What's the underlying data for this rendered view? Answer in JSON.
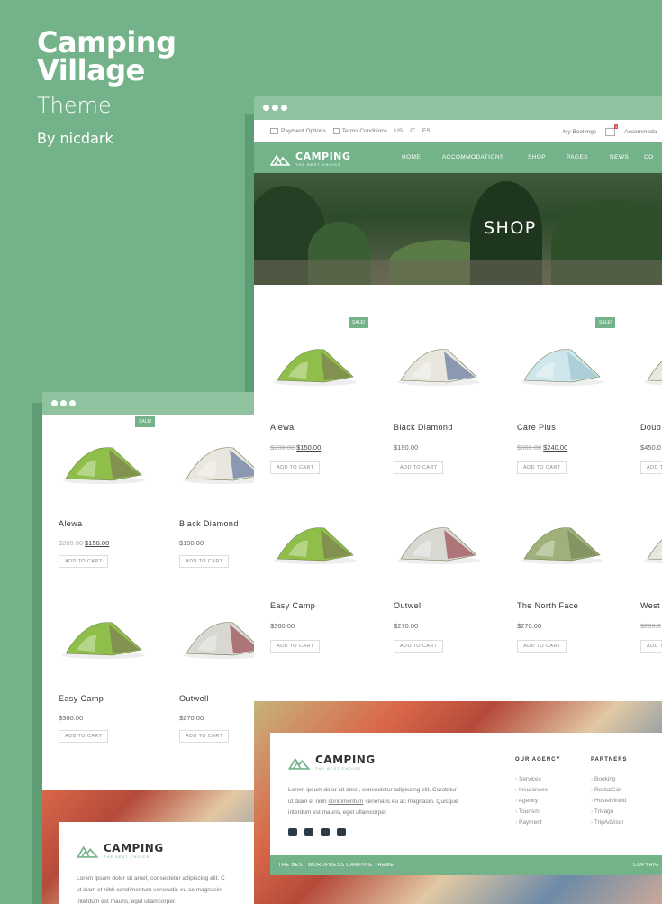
{
  "hero": {
    "title_line1": "Camping",
    "title_line2": "Village",
    "subtitle": "Theme",
    "byline": "By nicdark"
  },
  "topbar": {
    "payment": "Payment Options",
    "terms": "Terms Conditions",
    "langs": [
      "US",
      "IT",
      "ES"
    ],
    "bookings": "My Bookings",
    "cart_count": "1",
    "account": "Accommoda"
  },
  "logo": {
    "name": "CAMPING",
    "tagline": "THE BEST CHOICE"
  },
  "nav": [
    "HOME",
    "ACCOMMODATIONS",
    "SHOP",
    "PAGES",
    "NEWS",
    "CO"
  ],
  "banner": {
    "title": "SHOP"
  },
  "sale_badge": "SALE!",
  "add_to_cart": "ADD TO CART",
  "products": [
    {
      "name": "Alewa",
      "old_price": "$200.00",
      "price": "$150.00"
    },
    {
      "name": "Black Diamond",
      "old_price": "",
      "price": "$190.00"
    },
    {
      "name": "Care Plus",
      "old_price": "$300.00",
      "price": "$240.00"
    },
    {
      "name": "Doub",
      "old_price": "",
      "price": "$450.0"
    },
    {
      "name": "Easy Camp",
      "old_price": "",
      "price": "$360.00"
    },
    {
      "name": "Outwell",
      "old_price": "",
      "price": "$270.00"
    },
    {
      "name": "The North Face",
      "old_price": "",
      "price": "$270.00"
    },
    {
      "name": "West",
      "old_price": "$200.0",
      "price": ""
    }
  ],
  "footer": {
    "text_line1": "Lorem ipsum dolor sit amet, consectetur adipiscing elit. Curabitur",
    "text_line2_a": "ut diam et nibh ",
    "text_line2_link": "condimentum",
    "text_line2_b": " venenatis eu ac magnasin. Quisque",
    "text_line3": "interdum est mauris, eget ullamcorper.",
    "agency_title": "OUR AGENCY",
    "agency": [
      "Services",
      "Insurancee",
      "Agency",
      "Tourism",
      "Payment"
    ],
    "partners_title": "PARTNERS",
    "partners": [
      "Booking",
      "RentalCar",
      "HostelWorld",
      "Trivago",
      "TripAdvisor"
    ],
    "strip_left": "THE BEST WORDPRESS CAMPING THEME",
    "strip_right": "COPYRIG"
  },
  "small": {
    "products": [
      {
        "name": "Alewa",
        "old_price": "$200.00",
        "price": "$150.00"
      },
      {
        "name": "Black Diamond",
        "price": "$190.00"
      },
      {
        "name": "Easy Camp",
        "price": "$360.00"
      },
      {
        "name": "Outwell",
        "price": "$270.00"
      }
    ],
    "footer_text1": "Lorem ipsum dolor sit amet, consectetur adipiscing elit. C",
    "footer_text2": "ut diam et nibh condimentum venenatis eu ac magnasin.",
    "footer_text3": "interdum est mauris, eget ullamcorper."
  },
  "colors": {
    "brand": "#74b38a",
    "brand_dark": "#5e9d74",
    "bar": "#8fc39f"
  }
}
